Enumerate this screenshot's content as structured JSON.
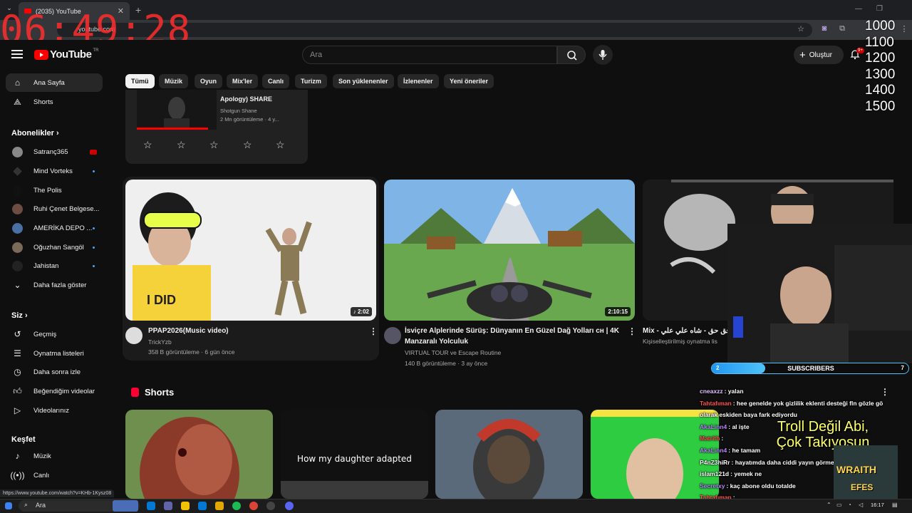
{
  "browser": {
    "tab_title": "(2035) YouTube",
    "address": "youtube.com",
    "status_url": "https://www.youtube.com/watch?v=KHb-1Kysz08"
  },
  "overlay": {
    "clock": "06:49:28",
    "numbers": [
      "1000",
      "1100",
      "1200",
      "1300",
      "1400",
      "1500"
    ]
  },
  "header": {
    "logo": "YouTube",
    "logo_suffix": "TR",
    "search_placeholder": "Ara",
    "create_label": "Oluştur",
    "notif_badge": "9+"
  },
  "sidebar": {
    "main": [
      {
        "label": "Ana Sayfa",
        "icon": "home-icon"
      },
      {
        "label": "Shorts",
        "icon": "shorts-icon"
      }
    ],
    "subs_heading": "Abonelikler",
    "subs": [
      {
        "label": "Satranç365",
        "status": "live"
      },
      {
        "label": "Mind Vorteks",
        "status": "new"
      },
      {
        "label": "The Polis",
        "status": "none"
      },
      {
        "label": "Ruhi Çenet Belgese...",
        "status": "none"
      },
      {
        "label": "AMERİKA DEPO ...",
        "status": "new"
      },
      {
        "label": "Oğuzhan Sangöl",
        "status": "new"
      },
      {
        "label": "Jahistan",
        "status": "new"
      }
    ],
    "show_more": "Daha fazla göster",
    "you_heading": "Siz",
    "you": [
      {
        "label": "Geçmiş",
        "icon": "history-icon"
      },
      {
        "label": "Oynatma listeleri",
        "icon": "playlist-icon"
      },
      {
        "label": "Daha sonra izle",
        "icon": "clock-icon"
      },
      {
        "label": "Beğendiğim videolar",
        "icon": "like-icon"
      },
      {
        "label": "Videolarınız",
        "icon": "video-icon"
      }
    ],
    "explore_heading": "Keşfet",
    "explore": [
      {
        "label": "Müzik",
        "icon": "music-icon"
      },
      {
        "label": "Canlı",
        "icon": "live-icon"
      }
    ]
  },
  "chips": [
    "Tümü",
    "Müzik",
    "Oyun",
    "Mix'ler",
    "Canlı",
    "Turizm",
    "Son yüklenenler",
    "İzlenenler",
    "Yeni öneriler"
  ],
  "survey": {
    "title": "Apology) SHARE",
    "channel": "Shotgun Shane",
    "meta": "2 Mn görüntüleme · 4 y..."
  },
  "videos": [
    {
      "title": "PPAP2026(Music video)",
      "channel": "TrickYzb",
      "meta": "358 B görüntüleme · 6 gün önce",
      "duration": "2:02"
    },
    {
      "title_line1": "İsviçre Alplerinde Sürüş: Dünyanın En Güzel Dağ Yolları ᴄʜ | 4K",
      "title_line2": "Manzaralı Yolculuk",
      "channel": "VIRTUAL TOUR ve Escape Routine",
      "meta": "140 B görüntüleme · 3 ay önce",
      "duration": "2:10:15"
    },
    {
      "title": "Mix - ون حق حق - شاه علي علي",
      "meta": "Kişiselleştirilmiş oynatma lis"
    }
  ],
  "shorts": {
    "heading": "Shorts",
    "s2_text": "How my daughter adapted"
  },
  "stream": {
    "sub_current": "2",
    "sub_label": "SUBSCRIBERS",
    "sub_goal": "7",
    "sub_progress": 0.27,
    "chat": [
      {
        "user": "cneaxzz",
        "msg": ": yalan",
        "color": "#e0c0ff"
      },
      {
        "user": "Tahtafıman",
        "msg": ": hee genelde yok gizlilik eklenti desteği fln gözle gö",
        "color": "#ff5252"
      },
      {
        "user": "",
        "msg": "olarak eskiden baya fark ediyordu",
        "color": "#fff"
      },
      {
        "user": "AkaLinn4",
        "msg": ": al işte",
        "color": "#b388ff"
      },
      {
        "user": "Matrith",
        "msg": ":",
        "color": "#ff5252"
      },
      {
        "user": "AkaLinn4",
        "msg": ": he tamam",
        "color": "#b388ff"
      },
      {
        "user": "P4nZ3hiRr",
        "msg": ": hayatımda daha ciddi yayın görme",
        "color": "#ffffff"
      },
      {
        "user": "islam121d",
        "msg": ": yemek ne",
        "color": "#ffffff"
      },
      {
        "user": "Secretxy",
        "msg": ": kaç abone oldu totalde",
        "color": "#b388ff"
      },
      {
        "user": "Tahtafıman",
        "msg": ":",
        "color": "#ff5252"
      }
    ],
    "troll_line1": "Troll Değil Abi,",
    "troll_line2": "Çok Takıyosun",
    "wraith": "WRAITH",
    "efes": "EFES"
  },
  "taskbar": {
    "search": "Ara",
    "time": "16:17"
  }
}
